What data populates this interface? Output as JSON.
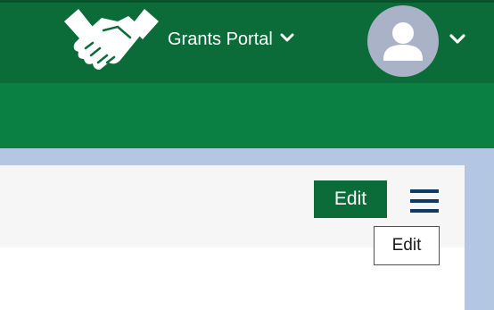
{
  "header": {
    "portal_label": "Grants Portal",
    "logo_icon": "handshake-icon",
    "portal_menu_icon": "chevron-down-icon",
    "avatar_icon": "user-avatar-icon",
    "avatar_menu_icon": "chevron-down-icon"
  },
  "toolbar": {
    "edit_label": "Edit",
    "menu_icon": "hamburger-menu-icon"
  },
  "tooltip": {
    "text": "Edit"
  },
  "colors": {
    "header_bg": "#0b6b39",
    "nav_bg": "#0a8042",
    "avatar_bg": "#a9b2c6",
    "frame_bg": "#b3c6e2",
    "menu_icon": "#0d3b66"
  }
}
